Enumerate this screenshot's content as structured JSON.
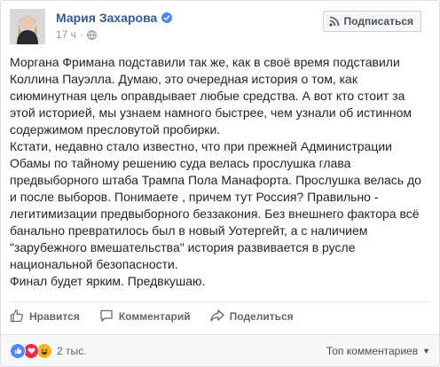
{
  "author": {
    "name": "Мария Захарова",
    "timestamp": "17 ч",
    "separator": "·"
  },
  "header": {
    "subscribe_label": "Подписаться"
  },
  "post": {
    "paragraphs": [
      "Моргана Фримана подставили так же, как в своё время подставили Коллина Пауэлла. Думаю, это очередная история о том, как сиюминутная цель оправдывает любые средства. А вот кто стоит за этой историей, мы узнаем намного быстрее, чем узнали об истинном содержимом пресловутой пробирки.",
      "Кстати, недавно стало известно, что при прежней Администрации Обамы по тайному решению суда велась прослушка глава предвыборного штаба Трампа Пола Манафорта. Прослушка велась до и после выборов. Понимаете , причем тут Россия? Правильно - легитимизации предвыборного беззакония. Без внешнего фактора всё банально превратилось был в новый Уотергейт, а с наличием \"зарубежного вмешательства\" история развивается в русле национальной безопасности.",
      "Финал будет ярким. Предвкушаю."
    ]
  },
  "actions": {
    "like_label": "Нравится",
    "comment_label": "Комментарий",
    "share_label": "Поделиться"
  },
  "stats": {
    "reactions_count": "2 тыс.",
    "sort_label": "Топ комментариев",
    "reaction_icons": [
      "like-icon",
      "love-icon",
      "haha-icon"
    ]
  },
  "colors": {
    "name": "#365899",
    "verified": "#4b88ff",
    "text": "#1d2129",
    "meta": "#90949c"
  }
}
